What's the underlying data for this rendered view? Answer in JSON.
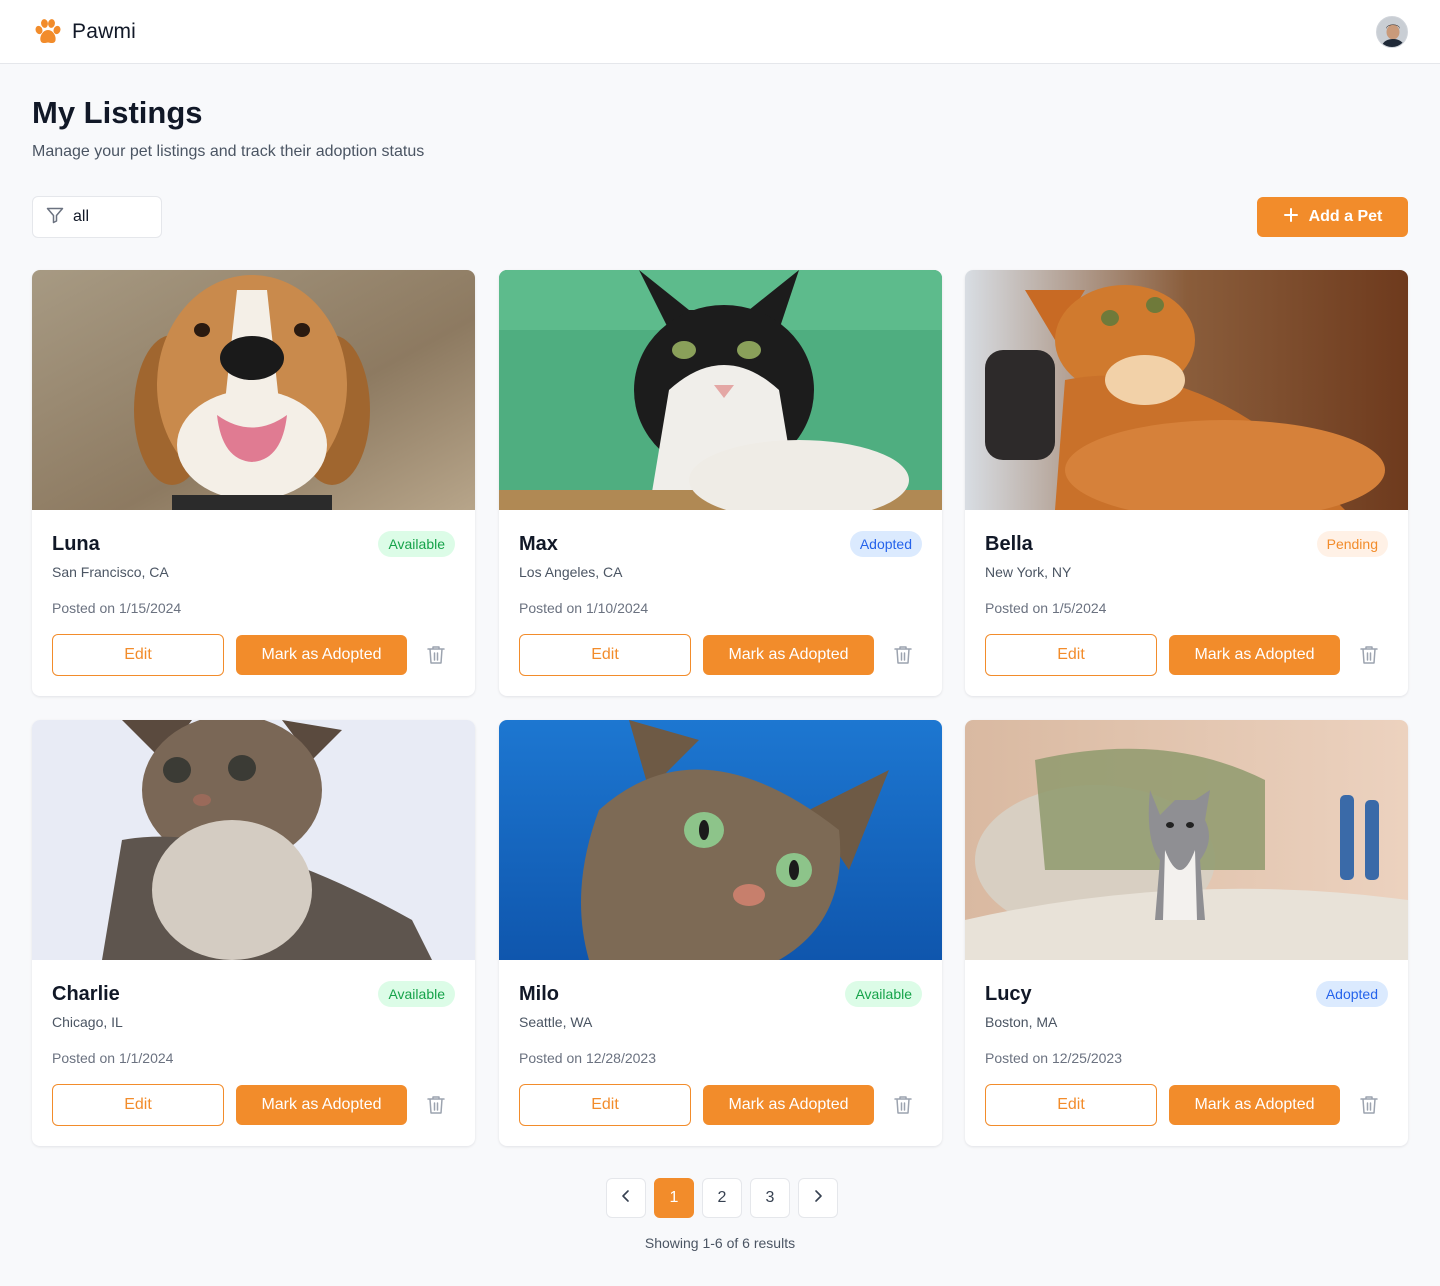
{
  "app": {
    "name": "Pawmi",
    "logo_icon": "paw-icon",
    "accent": "#f28c2b"
  },
  "header": {
    "avatar_label": "user-avatar"
  },
  "page": {
    "title": "My Listings",
    "subtitle": "Manage your pet listings and track their adoption status"
  },
  "toolbar": {
    "filter_icon": "filter-icon",
    "filter_value": "all",
    "add_label": "Add a Pet"
  },
  "status_colors": {
    "Available": "#16a34a",
    "Adopted": "#2563eb",
    "Pending": "#f28c2b"
  },
  "listings": [
    {
      "name": "Luna",
      "status": "Available",
      "location": "San Francisco, CA",
      "posted": "Posted on 1/15/2024",
      "edit": "Edit",
      "adopt": "Mark as Adopted",
      "photo": "beagle dog"
    },
    {
      "name": "Max",
      "status": "Adopted",
      "location": "Los Angeles, CA",
      "posted": "Posted on 1/10/2024",
      "edit": "Edit",
      "adopt": "Mark as Adopted",
      "photo": "black and white cat"
    },
    {
      "name": "Bella",
      "status": "Pending",
      "location": "New York, NY",
      "posted": "Posted on 1/5/2024",
      "edit": "Edit",
      "adopt": "Mark as Adopted",
      "photo": "orange cat"
    },
    {
      "name": "Charlie",
      "status": "Available",
      "location": "Chicago, IL",
      "posted": "Posted on 1/1/2024",
      "edit": "Edit",
      "adopt": "Mark as Adopted",
      "photo": "tabby kitten"
    },
    {
      "name": "Milo",
      "status": "Available",
      "location": "Seattle, WA",
      "posted": "Posted on 12/28/2023",
      "edit": "Edit",
      "adopt": "Mark as Adopted",
      "photo": "tabby cat on blue"
    },
    {
      "name": "Lucy",
      "status": "Adopted",
      "location": "Boston, MA",
      "posted": "Posted on 12/25/2023",
      "edit": "Edit",
      "adopt": "Mark as Adopted",
      "photo": "grey kitten on bed"
    }
  ],
  "pagination": {
    "prev_icon": "chevron-left-icon",
    "next_icon": "chevron-right-icon",
    "pages": [
      "1",
      "2",
      "3"
    ],
    "current": "1",
    "summary": "Showing 1-6 of 6 results"
  }
}
